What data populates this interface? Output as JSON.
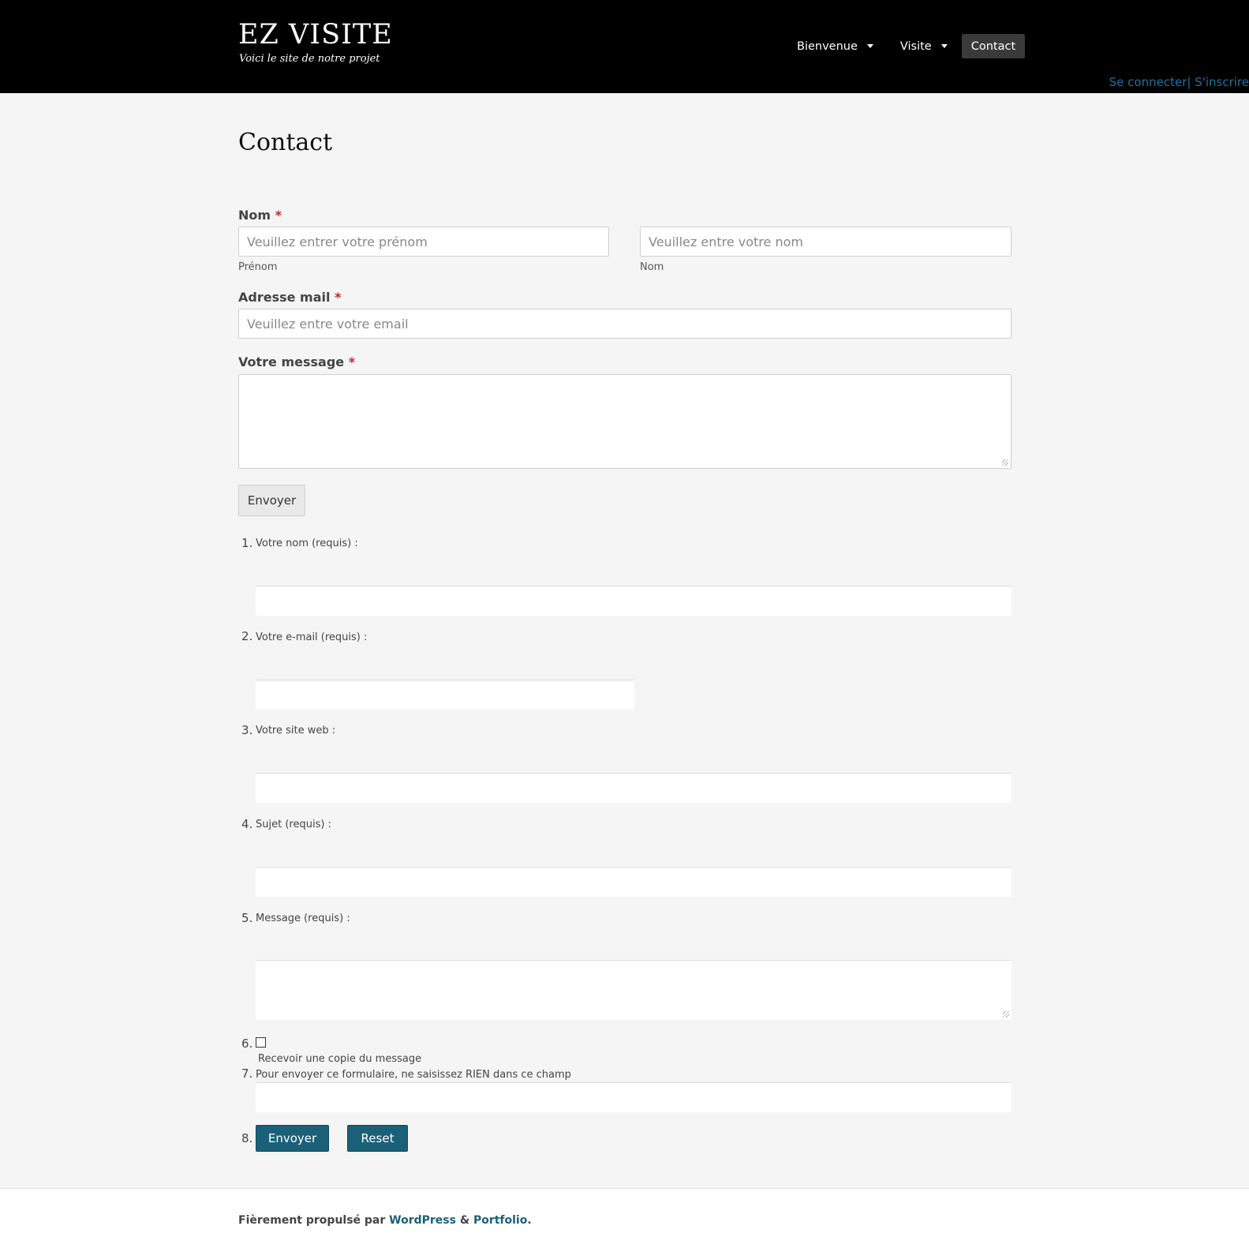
{
  "header": {
    "site_title": "EZ VISITE",
    "tagline": "Voici le site de notre projet",
    "nav": [
      {
        "label": "Bienvenue"
      },
      {
        "label": "Visite"
      },
      {
        "label": "Contact"
      }
    ],
    "account": {
      "login": "Se connecter",
      "separator": "| ",
      "register": "S'inscrire"
    }
  },
  "page": {
    "title": "Contact"
  },
  "form1": {
    "name_label": "Nom",
    "required_mark": "*",
    "first_name_placeholder": "Veuillez entrer votre prénom",
    "first_name_sublabel": "Prénom",
    "last_name_placeholder": "Veuillez entre votre nom",
    "last_name_sublabel": "Nom",
    "email_label": "Adresse mail",
    "email_placeholder": "Veuillez entre votre email",
    "message_label": "Votre message",
    "submit": "Envoyer"
  },
  "form2": {
    "items": [
      {
        "num": "1.",
        "label": "Votre nom (requis) :"
      },
      {
        "num": "2.",
        "label": "Votre e-mail (requis) :"
      },
      {
        "num": "3.",
        "label": "Votre site web :"
      },
      {
        "num": "4.",
        "label": "Sujet (requis) :"
      },
      {
        "num": "5.",
        "label": "Message (requis) :"
      },
      {
        "num": "6.",
        "label": "Recevoir une copie du message"
      },
      {
        "num": "7.",
        "label": "Pour envoyer ce formulaire, ne saisissez RIEN dans ce champ"
      },
      {
        "num": "8."
      }
    ],
    "send": "Envoyer",
    "reset": "Reset"
  },
  "footer": {
    "prefix": "Fièrement propulsé par ",
    "wordpress": "WordPress",
    "amp": " & ",
    "portfolio": "Portfolio",
    "suffix": "."
  },
  "colors": {
    "header_bg": "#000000",
    "link": "#22709e",
    "button_blue": "#1a6079",
    "required": "#c0272d"
  }
}
